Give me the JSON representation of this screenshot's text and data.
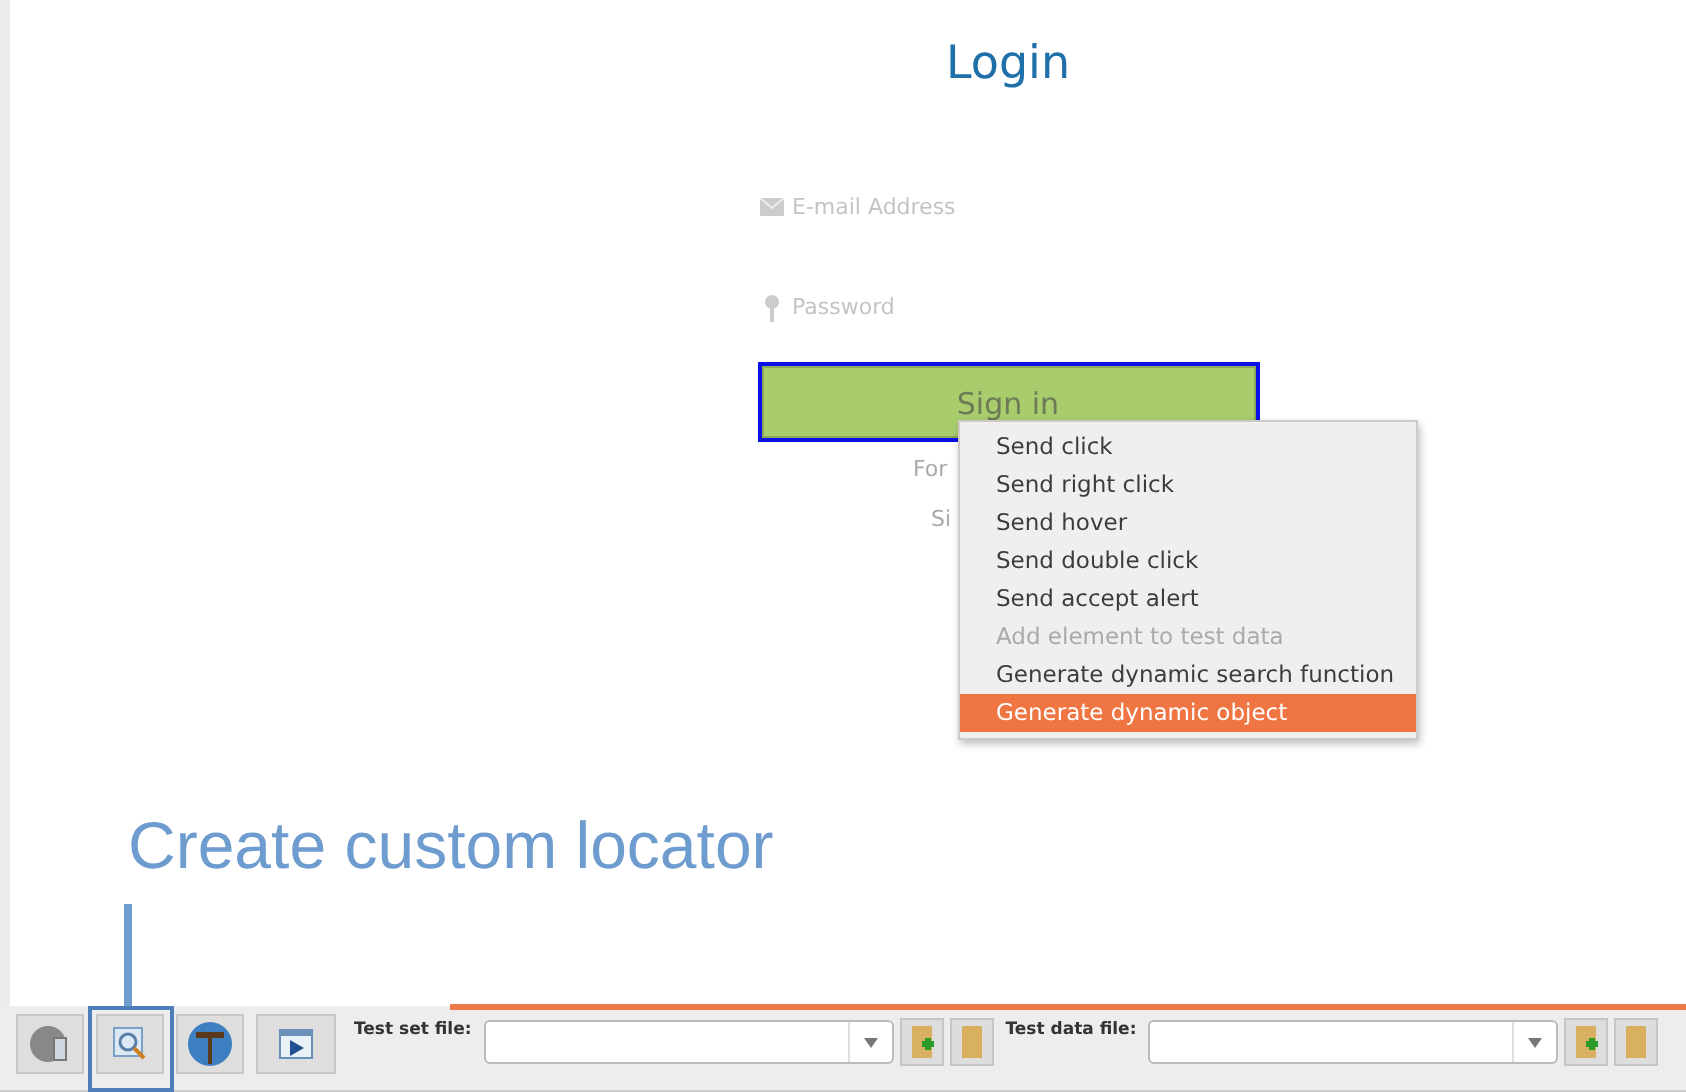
{
  "login": {
    "title": "Login",
    "email": {
      "placeholder": "E-mail Address"
    },
    "password": {
      "placeholder": "Password"
    },
    "sign_in": {
      "label": "Sign in",
      "focused": true
    },
    "forgot_link": "For",
    "signup_link": "Si"
  },
  "context_menu": {
    "items": [
      {
        "label": "Send click",
        "disabled": false,
        "selected": false
      },
      {
        "label": "Send right click",
        "disabled": false,
        "selected": false
      },
      {
        "label": "Send hover",
        "disabled": false,
        "selected": false
      },
      {
        "label": "Send double click",
        "disabled": false,
        "selected": false
      },
      {
        "label": "Send accept alert",
        "disabled": false,
        "selected": false
      },
      {
        "label": "Add element to test data",
        "disabled": true,
        "selected": false
      },
      {
        "label": "Generate dynamic search function",
        "disabled": false,
        "selected": false
      },
      {
        "label": "Generate dynamic object",
        "disabled": false,
        "selected": true
      }
    ]
  },
  "annotation": {
    "text": "Create custom locator"
  },
  "toolbar": {
    "tools": [
      {
        "kind": "globe"
      },
      {
        "kind": "locator"
      },
      {
        "kind": "hammer"
      },
      {
        "kind": "play"
      }
    ],
    "test_set_label": "Test set file:",
    "test_data_label": "Test data file:"
  }
}
